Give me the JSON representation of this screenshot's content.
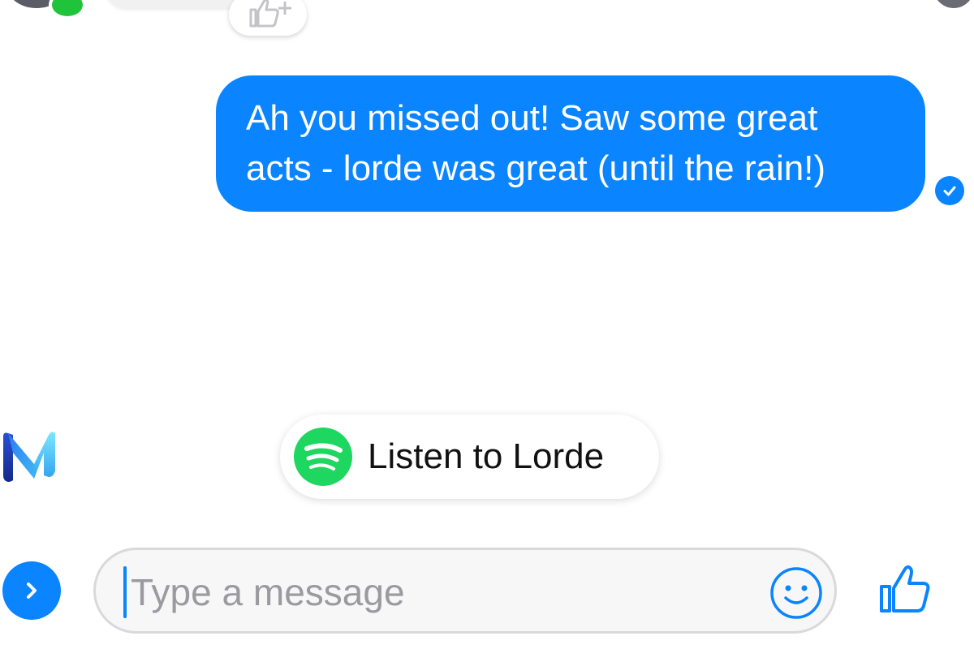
{
  "conversation": {
    "previous_message": {
      "reaction_icon": "thumbs-up-add-icon"
    },
    "outgoing_message": {
      "lines": [
        "Ah you missed out! Saw some great",
        "acts - lorde was great (until the rain!)"
      ],
      "status_icon": "check-circle-icon"
    }
  },
  "suggestion": {
    "assistant_icon": "m-assistant-icon",
    "chip": {
      "icon": "spotify-icon",
      "label": "Listen to Lorde"
    }
  },
  "composer": {
    "expand_icon": "chevron-right-icon",
    "input_placeholder": "Type a message",
    "emoji_icon": "smiley-icon",
    "like_icon": "thumbs-up-icon"
  },
  "colors": {
    "accent": "#0a84ff",
    "online": "#20c43a",
    "spotify": "#1ed760"
  }
}
